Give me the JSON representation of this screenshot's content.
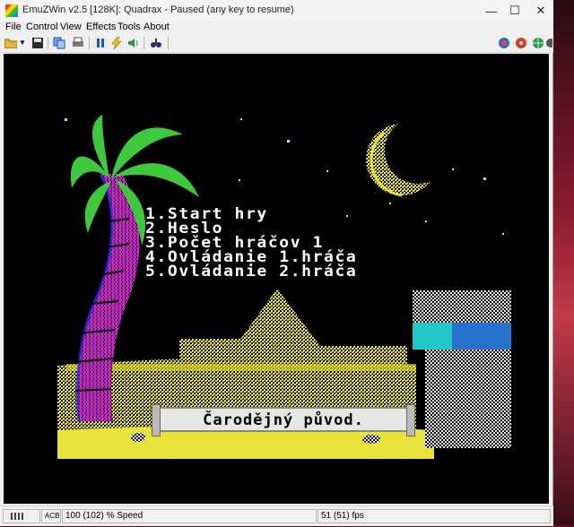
{
  "window": {
    "title": "EmuZWin v2.5 [128K]: Quadrax - Paused (any key to resume)",
    "minimize": "—",
    "maximize": "☐",
    "close": "✕"
  },
  "menu": [
    "File",
    "Control",
    "View",
    "Effects",
    "Tools",
    "About"
  ],
  "game": {
    "menu_lines": [
      "1.Start hry",
      "2.Heslo",
      "3.Počet hráčov 1",
      "4.Ovládanie 1.hráča",
      "5.Ovládanie 2.hráča"
    ],
    "banner": "Čarodějný původ."
  },
  "status": {
    "indicator": "ACB",
    "speed": "100 (102) % Speed",
    "fps": "51 (51) fps"
  },
  "colors": {
    "palm_leaves": "#3ec83e",
    "palm_trunk": "#d21fd2",
    "sand": "#e8e23a",
    "moon": "#e8e23a",
    "water": "#22c6c6"
  }
}
